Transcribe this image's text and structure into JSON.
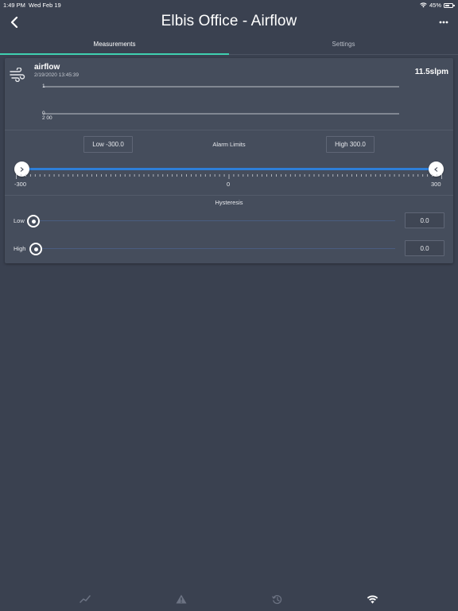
{
  "status_bar": {
    "time": "1:49 PM",
    "date": "Wed Feb 19",
    "battery": "45%",
    "battery_level": 0.45
  },
  "nav": {
    "title": "Elbis Office - Airflow"
  },
  "tabs": [
    {
      "label": "Measurements",
      "active": true
    },
    {
      "label": "Settings",
      "active": false
    }
  ],
  "sensor": {
    "name": "airflow",
    "timestamp": "2/19/2020 13:45:39",
    "value": "11.5slpm",
    "icon": "wind-icon"
  },
  "mini_chart": {
    "y_ticks": [
      "1",
      "0"
    ],
    "x_ticks": [
      "2 00"
    ]
  },
  "alarm_limits": {
    "label": "Alarm Limits",
    "low_label": "Low -300.0",
    "high_label": "High 300.0",
    "low_value": -300,
    "high_value": 300,
    "min": -300,
    "max": 300,
    "axis_labels": [
      "-300",
      "0",
      "300"
    ]
  },
  "hysteresis": {
    "title": "Hysteresis",
    "low": {
      "label": "Low",
      "value": "0.0"
    },
    "high": {
      "label": "High",
      "value": "0.0"
    }
  },
  "colors": {
    "background": "#3a4150",
    "card": "#454d5c",
    "accent_teal": "#3fd0b0",
    "slider_blue": "#2e7fd8"
  },
  "bottom_tabs": [
    {
      "icon": "trend-chart-icon",
      "active": false
    },
    {
      "icon": "warning-icon",
      "active": false
    },
    {
      "icon": "history-icon",
      "active": false
    },
    {
      "icon": "wifi-icon",
      "active": true
    }
  ]
}
